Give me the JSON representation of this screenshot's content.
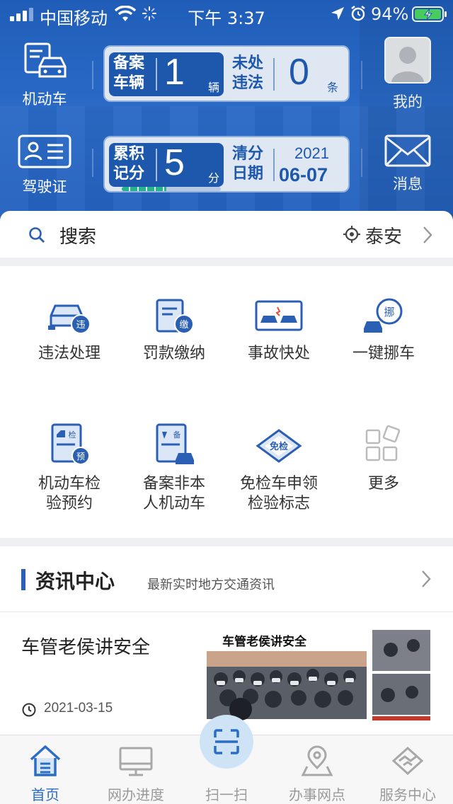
{
  "status_bar": {
    "carrier": "中国移动",
    "time": "下午 3:37",
    "battery_pct": "94%"
  },
  "header": {
    "vehicle_label": "机动车",
    "license_label": "驾驶证",
    "my_label": "我的",
    "message_label": "消息",
    "card1": {
      "left_label": "备案车辆",
      "left_value": "1",
      "left_unit": "辆",
      "right_label": "未处违法",
      "right_value": "0",
      "right_unit": "条"
    },
    "card2": {
      "left_label": "累积记分",
      "left_value": "5",
      "left_unit": "分",
      "right_label": "清分日期",
      "date_year": "2021",
      "date_md": "06-07",
      "score_progress": 0.45
    }
  },
  "search": {
    "label": "搜索",
    "city": "泰安"
  },
  "services": [
    {
      "label": "违法处理",
      "icon": "violation-icon"
    },
    {
      "label": "罚款缴纳",
      "icon": "fine-payment-icon"
    },
    {
      "label": "事故快处",
      "icon": "accident-icon"
    },
    {
      "label": "一键挪车",
      "icon": "move-car-icon"
    },
    {
      "label_line1": "机动车检",
      "label_line2": "验预约",
      "icon": "inspection-booking-icon"
    },
    {
      "label_line1": "备案非本",
      "label_line2": "人机动车",
      "icon": "register-vehicle-icon"
    },
    {
      "label_line1": "免检车申领",
      "label_line2": "检验标志",
      "icon": "exempt-inspection-icon"
    },
    {
      "label": "更多",
      "icon": "more-icon"
    }
  ],
  "news": {
    "title": "资讯中心",
    "subtitle": "最新实时地方交通资讯",
    "article": {
      "title": "车管老侯讲安全",
      "date": "2021-03-15",
      "image_caption": "车管老侯讲安全"
    }
  },
  "bottom_nav": [
    {
      "label": "首页",
      "icon": "home-icon",
      "active": true
    },
    {
      "label": "网办进度",
      "icon": "monitor-icon",
      "active": false
    },
    {
      "label": "扫一扫",
      "icon": "scan-icon",
      "active": false
    },
    {
      "label": "办事网点",
      "icon": "location-pin-icon",
      "active": false
    },
    {
      "label": "服务中心",
      "icon": "handshake-icon",
      "active": false
    }
  ],
  "colors": {
    "primary": "#2461bd",
    "active_nav": "#2b6cc4",
    "progress": "#26b48c"
  }
}
